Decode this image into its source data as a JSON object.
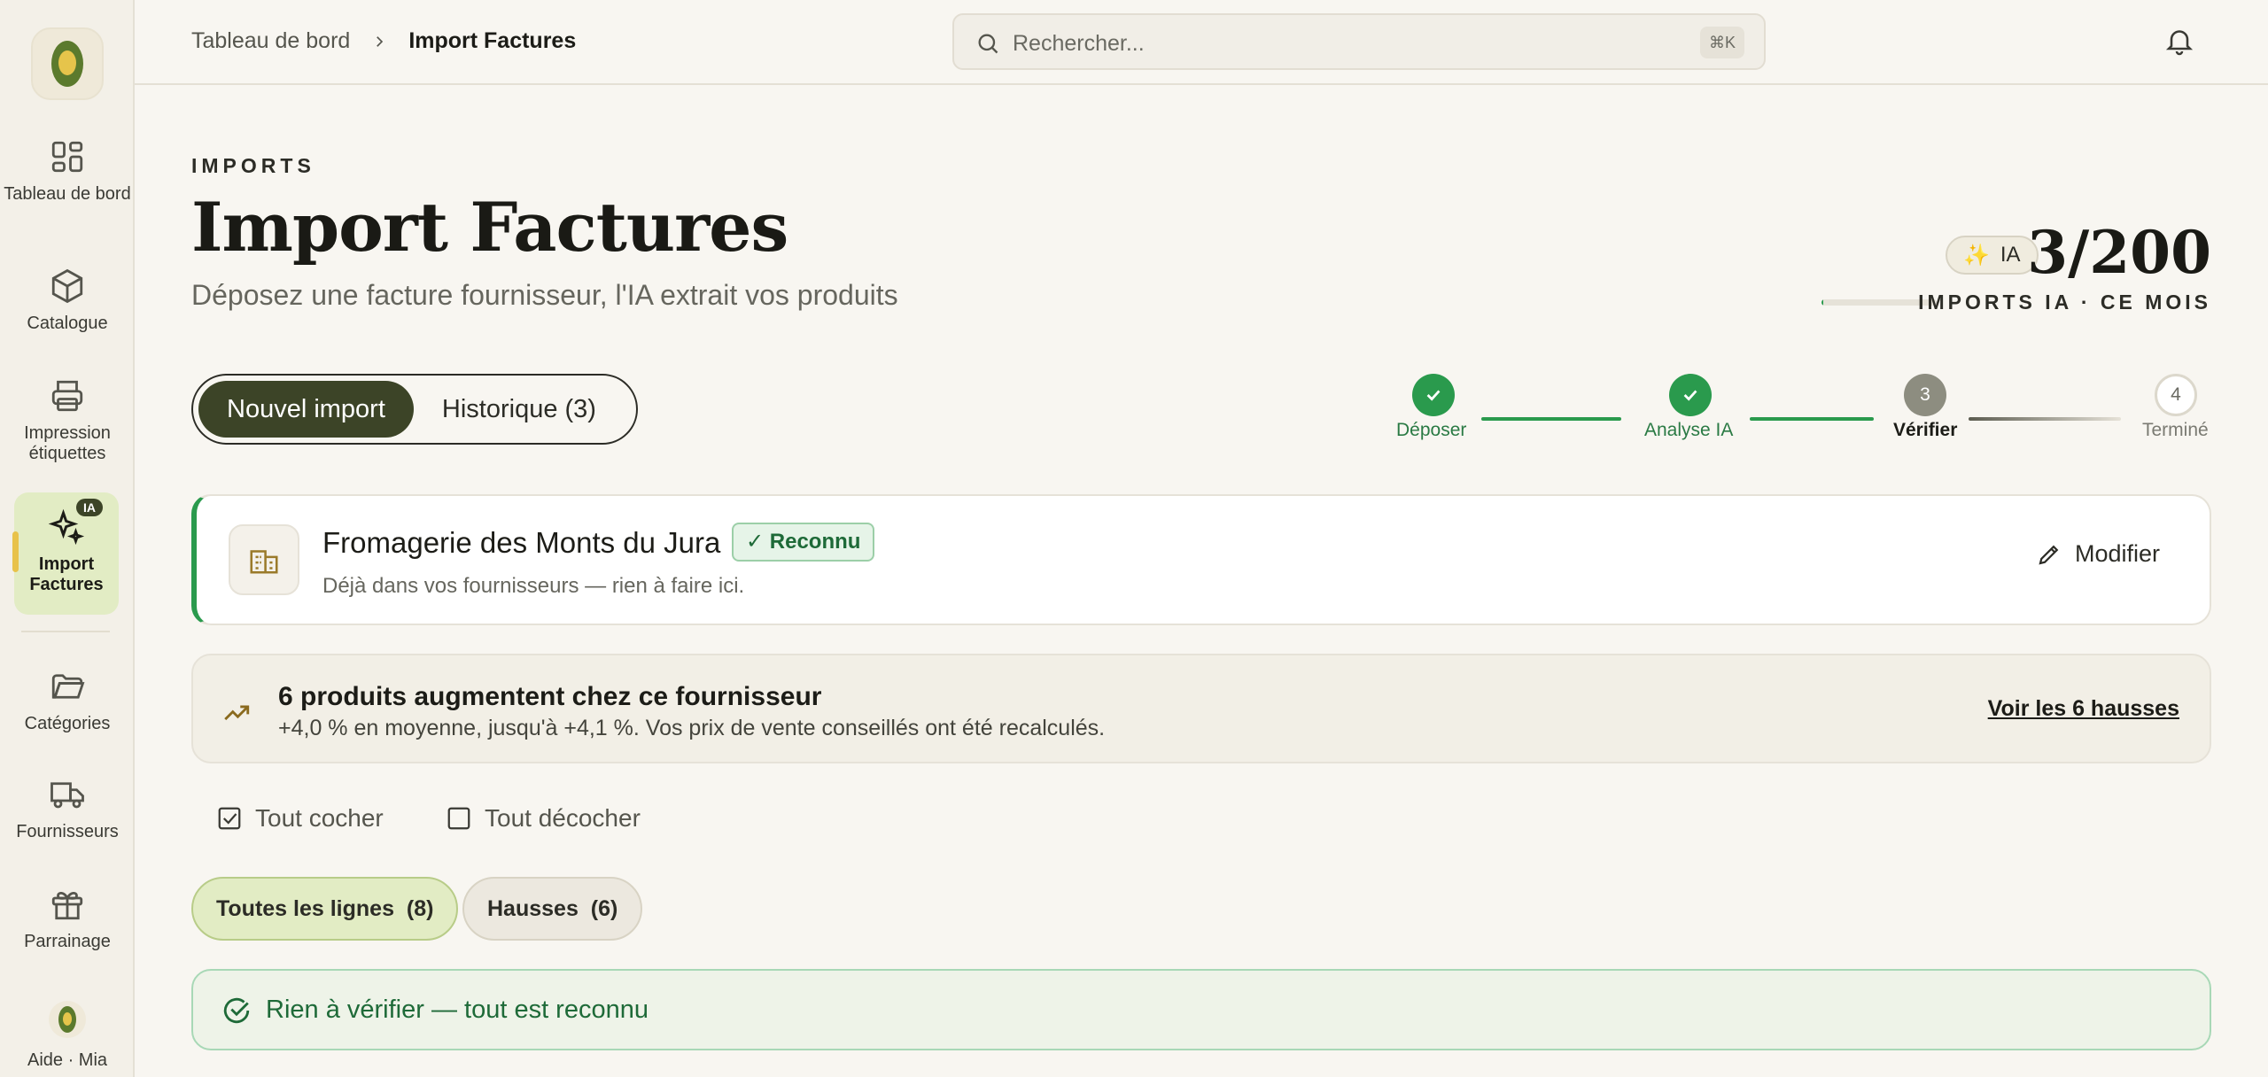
{
  "sidebar": {
    "items": [
      {
        "label": "Tableau de bord",
        "icon": "dashboard-icon"
      },
      {
        "label": "Catalogue",
        "icon": "box-icon"
      },
      {
        "label": "Impression étiquettes",
        "icon": "printer-icon"
      },
      {
        "label": "Import Factures",
        "icon": "sparkles-icon",
        "badge": "IA",
        "active": true
      },
      {
        "label": "Catégories",
        "icon": "folder-icon"
      },
      {
        "label": "Fournisseurs",
        "icon": "truck-icon"
      },
      {
        "label": "Parrainage",
        "icon": "gift-icon"
      }
    ],
    "help_label": "Aide · Mia"
  },
  "topbar": {
    "breadcrumb": [
      "Tableau de bord",
      "Import Factures"
    ],
    "search_placeholder": "Rechercher...",
    "search_shortcut": "⌘K"
  },
  "header": {
    "eyebrow": "IMPORTS",
    "title": "Import Factures",
    "subtitle": "Déposez une facture fournisseur, l'IA extrait vos produits"
  },
  "quota": {
    "pill_label": "IA",
    "value": "3/200",
    "used": 3,
    "limit": 200,
    "label": "IMPORTS IA · CE MOIS"
  },
  "tabs": [
    {
      "label": "Nouvel import",
      "active": true
    },
    {
      "label": "Historique (3)",
      "active": false
    }
  ],
  "stepper": {
    "steps": [
      {
        "number": "1",
        "label": "Déposer",
        "state": "done"
      },
      {
        "number": "2",
        "label": "Analyse IA",
        "state": "done"
      },
      {
        "number": "3",
        "label": "Vérifier",
        "state": "current"
      },
      {
        "number": "4",
        "label": "Terminé",
        "state": "todo"
      }
    ]
  },
  "supplier": {
    "name": "Fromagerie des Monts du Jura",
    "badge": "Reconnu",
    "subtitle": "Déjà dans vos fournisseurs — rien à faire ici.",
    "modify_label": "Modifier"
  },
  "price_alert": {
    "title": "6 produits augmentent chez ce fournisseur",
    "subtitle": "+4,0 % en moyenne, jusqu'à +4,1 %. Vos prix de vente conseillés ont été recalculés.",
    "link": "Voir les 6 hausses"
  },
  "checks": {
    "check_all": "Tout cocher",
    "uncheck_all": "Tout décocher"
  },
  "filters": [
    {
      "label": "Toutes les lignes",
      "count": "(8)",
      "active": true
    },
    {
      "label": "Hausses",
      "count": "(6)",
      "active": false
    }
  ],
  "success": {
    "text": "Rien à vérifier — tout est reconnu"
  },
  "colors": {
    "accent_green": "#2a9a4d",
    "dark_olive": "#3c4427",
    "background": "#f8f6f1"
  }
}
